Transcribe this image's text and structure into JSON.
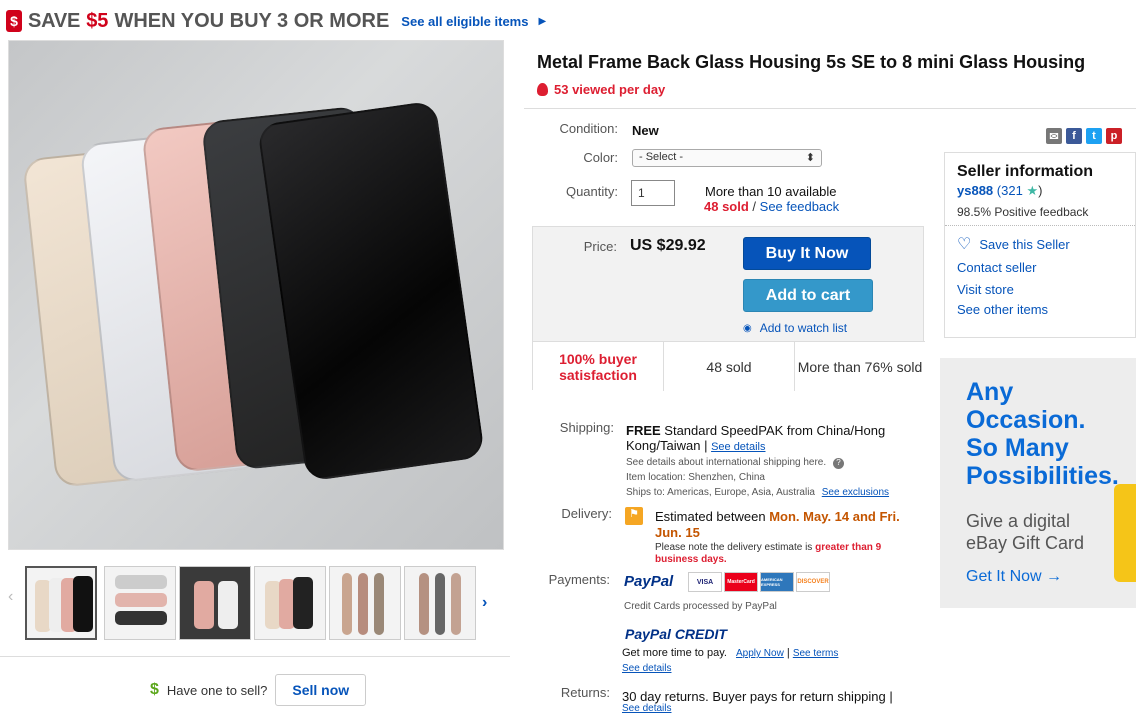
{
  "promo": {
    "icon": "dollar-tag-icon",
    "save_prefix": "SAVE",
    "save_amount": "$5",
    "save_suffix": "WHEN YOU BUY 3 OR MORE",
    "see_all": "See all eligible items"
  },
  "listing": {
    "title": "Metal Frame Back Glass Housing 5s SE to 8 mini Glass Housing",
    "viewed": "53 viewed per day",
    "condition_label": "Condition:",
    "condition_value": "New",
    "color_label": "Color:",
    "color_select": "- Select -",
    "quantity_label": "Quantity:",
    "quantity_value": "1",
    "available": "More than 10 available",
    "sold": "48 sold",
    "see_feedback": "See feedback",
    "price_label": "Price:",
    "price": "US $29.92",
    "buy_now": "Buy It Now",
    "add_to_cart": "Add to cart",
    "watch": "Add to watch list",
    "stats": [
      "100% buyer satisfaction",
      "48 sold",
      "More than 76% sold"
    ]
  },
  "shipping": {
    "label": "Shipping:",
    "free": "FREE",
    "method": "Standard SpeedPAK from China/Hong Kong/Taiwan",
    "see_details": "See details",
    "intl": "See details about international shipping here.",
    "location": "Item location:  Shenzhen, China",
    "ships_to": "Ships to:  Americas, Europe, Asia, Australia",
    "see_exclusions": "See exclusions"
  },
  "delivery": {
    "label": "Delivery:",
    "est_prefix": "Estimated between",
    "est_dates": "Mon. May. 14 and Fri. Jun. 15",
    "note": "Please note the delivery estimate is",
    "note_red": "greater than 9 business days."
  },
  "payments": {
    "label": "Payments:",
    "paypal": "PayPal",
    "cards": [
      "VISA",
      "MasterCard",
      "AMERICAN EXPRESS",
      "DISCOVER"
    ],
    "cards_note": "Credit Cards processed by PayPal",
    "credit": "PayPal CREDIT",
    "more_time": "Get more time to pay.",
    "apply": "Apply Now",
    "see_terms": "See terms",
    "see_details": "See details"
  },
  "returns": {
    "label": "Returns:",
    "text": "30 day returns. Buyer pays for return shipping |",
    "see_details": "See details"
  },
  "seller": {
    "heading": "Seller information",
    "name": "ys888",
    "score": "(321",
    "score_end": ")",
    "feedback": "98.5% Positive feedback",
    "save": "Save this Seller",
    "contact": "Contact seller",
    "store": "Visit store",
    "other": "See other items"
  },
  "ad": {
    "line1": "Any Occasion.",
    "line2": "So Many",
    "line3": "Possibilities.",
    "sub1": "Give a digital",
    "sub2": "eBay Gift Card",
    "cta": "Get It Now →"
  },
  "sell": {
    "prompt": "Have one to sell?",
    "button": "Sell now"
  },
  "colors": {
    "link": "#0654ba",
    "red": "#dd1e31",
    "buy": "#0654ba",
    "cart": "#3498ca"
  }
}
